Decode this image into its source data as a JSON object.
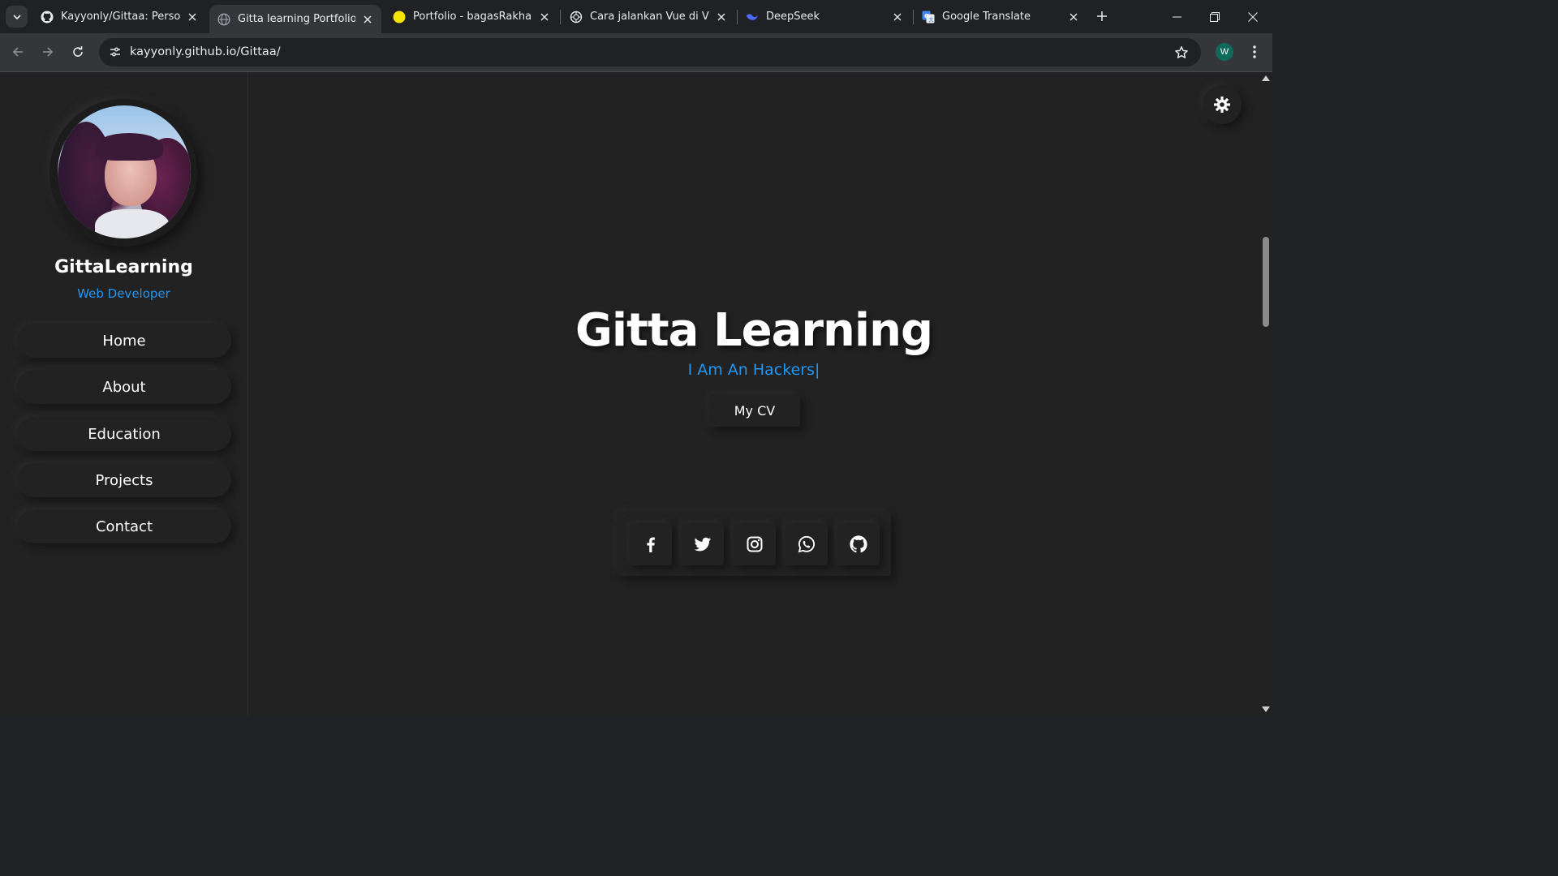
{
  "browser": {
    "tabs": [
      {
        "title": "Kayyonly/Gittaa: Personal F",
        "icon": "github-icon",
        "active": false
      },
      {
        "title": "Gitta learning Portfolio",
        "icon": "globe-icon",
        "active": true
      },
      {
        "title": "Portfolio - bagasRakha();",
        "icon": "yellow-circle-icon",
        "active": false
      },
      {
        "title": "Cara jalankan Vue di VSCo",
        "icon": "openai-icon",
        "active": false
      },
      {
        "title": "DeepSeek",
        "icon": "deepseek-icon",
        "active": false
      },
      {
        "title": "Google Translate",
        "icon": "google-translate-icon",
        "active": false
      }
    ],
    "url": "kayyonly.github.io/Gittaa/",
    "profile_initial": "W",
    "accent_color": "#35363a"
  },
  "sidebar": {
    "name": "GittaLearning",
    "role": "Web Developer",
    "nav": [
      {
        "label": "Home"
      },
      {
        "label": "About"
      },
      {
        "label": "Education"
      },
      {
        "label": "Projects"
      },
      {
        "label": "Contact"
      }
    ]
  },
  "hero": {
    "title": "Gitta Learning",
    "subtitle": "I Am An Hackers|",
    "cv_label": "My CV"
  },
  "social": [
    "facebook-icon",
    "twitter-icon",
    "instagram-icon",
    "whatsapp-icon",
    "github-icon"
  ],
  "theme": {
    "background": "#222222",
    "accent": "#2196f3",
    "text": "#ffffff"
  }
}
